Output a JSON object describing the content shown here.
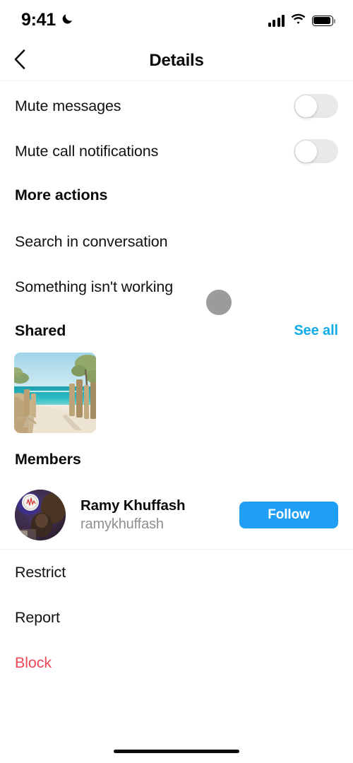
{
  "status_bar": {
    "time": "9:41",
    "dnd_icon": "crescent-moon-icon",
    "signal_icon": "cellular-signal-icon",
    "wifi_icon": "wifi-icon",
    "battery_icon": "battery-full-icon"
  },
  "header": {
    "back_icon": "chevron-left-icon",
    "title": "Details"
  },
  "settings": [
    {
      "label": "Mute messages",
      "toggle": "off"
    },
    {
      "label": "Mute call notifications",
      "toggle": "off"
    }
  ],
  "more_actions": {
    "title": "More actions",
    "items": [
      {
        "label": "Search in conversation"
      },
      {
        "label": "Something isn't working"
      }
    ]
  },
  "shared": {
    "title": "Shared",
    "see_all_label": "See all",
    "media": [
      {
        "alt": "beach-photo-thumbnail"
      }
    ]
  },
  "members": {
    "title": "Members",
    "list": [
      {
        "name": "Ramy Khuffash",
        "username": "ramykhuffash",
        "action_label": "Follow",
        "avatar": "user-avatar"
      }
    ]
  },
  "moderation": [
    {
      "label": "Restrict",
      "danger": false
    },
    {
      "label": "Report",
      "danger": false
    },
    {
      "label": "Block",
      "danger": true
    }
  ],
  "colors": {
    "accent_blue": "#1f9ef5",
    "link_blue": "#12abe6",
    "danger_red": "#ed4956",
    "toggle_track_off": "#e9e9eb",
    "secondary_text": "#8e8e93",
    "touch_indicator": "#9b9b9b"
  },
  "touch_indicator": {
    "visible": true
  }
}
